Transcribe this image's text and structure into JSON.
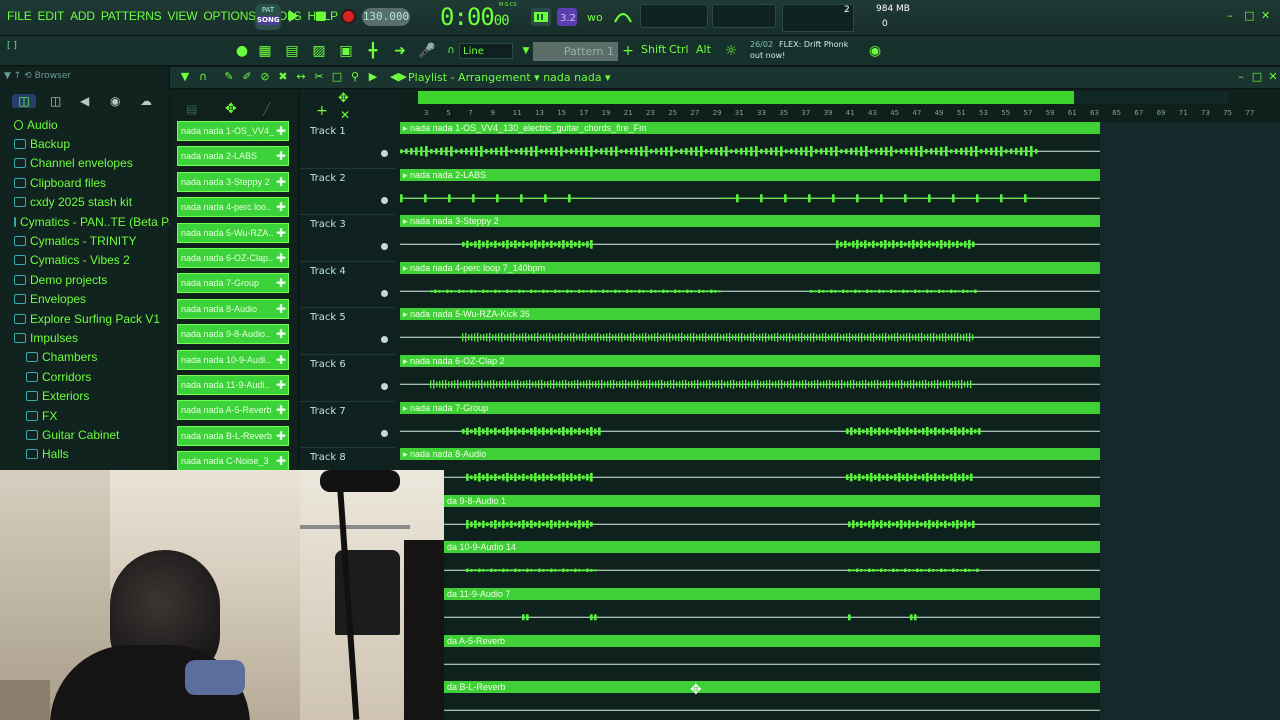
{
  "menu": [
    "FILE",
    "EDIT",
    "ADD",
    "PATTERNS",
    "VIEW",
    "OPTIONS",
    "TOOLS",
    "HELP"
  ],
  "transport": {
    "pat_label": "PAT",
    "song_label": "SONG",
    "tempo": "130.000",
    "time_main": "0:00",
    "time_ms": "00",
    "time_unit": "M:S:CS",
    "cpu_value": "2",
    "memory": "984 MB",
    "memory_sub": "0"
  },
  "toolbar2": {
    "hint": "[ ]",
    "snap": "Line",
    "pattern": "Pattern 1",
    "keys": [
      "Shift",
      "Ctrl",
      "Alt"
    ],
    "news_date": "26/02",
    "news_title": "FLEX: Drift Phonk",
    "news_text": "out now!"
  },
  "browser": {
    "title": "Browser",
    "items": [
      {
        "label": "Audio",
        "sub": false
      },
      {
        "label": "Backup",
        "sub": false
      },
      {
        "label": "Channel envelopes",
        "sub": false
      },
      {
        "label": "Clipboard files",
        "sub": false
      },
      {
        "label": "cxdy 2025 stash kit",
        "sub": false
      },
      {
        "label": "Cymatics - PAN..TE (Beta Pack)",
        "sub": false
      },
      {
        "label": "Cymatics - TRINITY",
        "sub": false
      },
      {
        "label": "Cymatics - Vibes 2",
        "sub": false
      },
      {
        "label": "Demo projects",
        "sub": false
      },
      {
        "label": "Envelopes",
        "sub": false
      },
      {
        "label": "Explore Surfing Pack V1",
        "sub": false
      },
      {
        "label": "Impulses",
        "sub": false
      },
      {
        "label": "Chambers",
        "sub": true
      },
      {
        "label": "Corridors",
        "sub": true
      },
      {
        "label": "Exteriors",
        "sub": true
      },
      {
        "label": "FX",
        "sub": true
      },
      {
        "label": "Guitar Cabinet",
        "sub": true
      },
      {
        "label": "Halls",
        "sub": true
      }
    ]
  },
  "playlist": {
    "title": "Playlist - Arrangement",
    "arrangement": "nada nada",
    "picker": [
      "nada nada 1-OS_VV4_",
      "nada nada 2-LABS",
      "nada nada 3-Steppy 2",
      "nada nada 4-perc loo..",
      "nada nada 5-Wu-RZA..",
      "nada nada 6-OZ-Clap..",
      "nada nada 7-Group",
      "nada nada 8-Audio",
      "nada nada 9-8-Audio..",
      "nada nada 10-9-Audi..",
      "nada nada 11-9-Audi..",
      "nada nada A-5-Reverb",
      "nada nada B-L-Reverb",
      "nada nada C-Noise_3"
    ],
    "tracks": [
      "Track 1",
      "Track 2",
      "Track 3",
      "Track 4",
      "Track 5",
      "Track 6",
      "Track 7",
      "Track 8"
    ],
    "ruler": [
      "3",
      "5",
      "7",
      "9",
      "11",
      "13",
      "15",
      "17",
      "19",
      "21",
      "23",
      "25",
      "27",
      "29",
      "31",
      "33",
      "35",
      "37",
      "39",
      "41",
      "43",
      "45",
      "47",
      "49",
      "51",
      "53",
      "55",
      "57",
      "59",
      "61",
      "63",
      "65",
      "67",
      "69",
      "71",
      "73",
      "75",
      "77"
    ],
    "clips": [
      "nada nada 1-OS_VV4_130_electric_guitar_chords_fire_Fm",
      "nada nada 2-LABS",
      "nada nada 3-Steppy 2",
      "nada nada 4-perc loop 7_140bpm",
      "nada nada 5-Wu-RZA-Kick 35",
      "nada nada 6-OZ-Clap 2",
      "nada nada 7-Group",
      "nada nada 8-Audio",
      "da 9-8-Audio 1",
      "da 10-9-Audio 14",
      "da 11-9-Audio 7",
      "da A-5-Reverb",
      "da B-L-Reverb"
    ]
  },
  "colors": {
    "accent": "#6dff3c",
    "clip": "#3fcf37",
    "background": "#10211e"
  }
}
